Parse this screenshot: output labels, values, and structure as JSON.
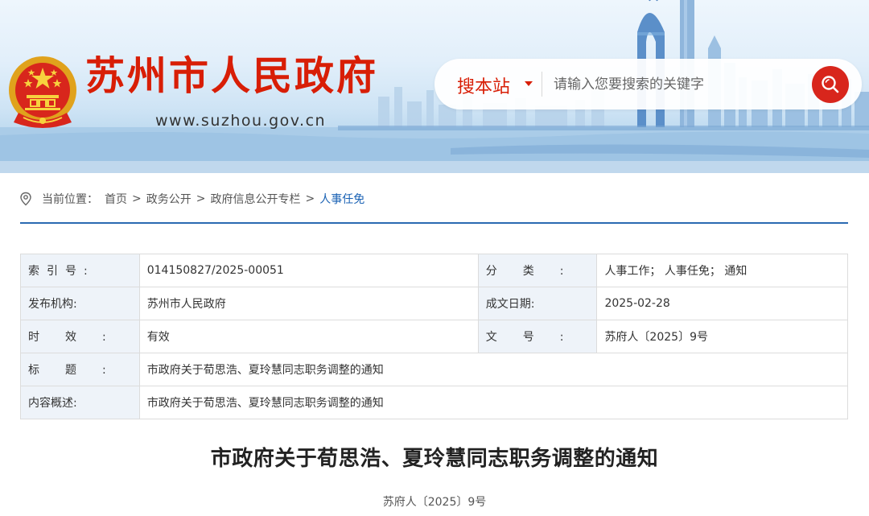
{
  "header": {
    "site_title": "苏州市人民政府",
    "site_url": "www.suzhou.gov.cn",
    "search": {
      "scope": "搜本站",
      "placeholder": "请输入您要搜索的关键字"
    }
  },
  "breadcrumb": {
    "prefix": "当前位置：",
    "items": [
      "首页",
      "政务公开",
      "政府信息公开专栏",
      "人事任免"
    ],
    "separator": ">"
  },
  "info_table": {
    "index_label": "索引号:",
    "index_value": "014150827/2025-00051",
    "category_label": "分类:",
    "category_value": "人事工作； 人事任免； 通知",
    "publisher_label": "发布机构:",
    "publisher_value": "苏州市人民政府",
    "date_label": "成文日期:",
    "date_value": "2025-02-28",
    "validity_label": "时效:",
    "validity_value": "有效",
    "docno_label": "文号:",
    "docno_value": "苏府人〔2025〕9号",
    "title_label": "标题:",
    "title_value": "市政府关于荀思浩、夏玲慧同志职务调整的通知",
    "summary_label": "内容概述:",
    "summary_value": "市政府关于荀思浩、夏玲慧同志职务调整的通知"
  },
  "article": {
    "title": "市政府关于荀思浩、夏玲慧同志职务调整的通知",
    "doc_number": "苏府人〔2025〕9号"
  },
  "colors": {
    "brand_red": "#d81e06",
    "link_blue": "#1a62b4",
    "rule_blue": "#2a6ab2",
    "label_bg": "#eef3f9"
  },
  "icons": [
    "national-emblem-icon",
    "caret-down-icon",
    "search-icon",
    "location-pin-icon"
  ]
}
